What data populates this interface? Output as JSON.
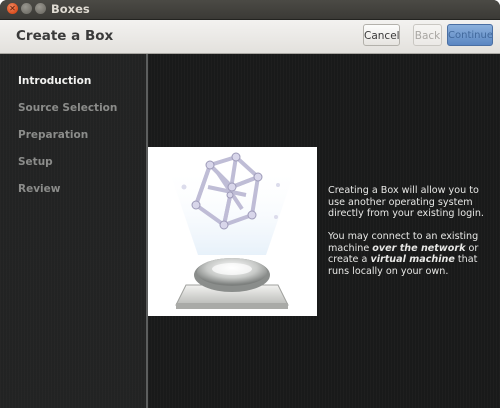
{
  "window": {
    "title": "Boxes"
  },
  "header": {
    "title": "Create a Box",
    "cancel_label": "Cancel",
    "back_label": "Back",
    "continue_label": "Continue"
  },
  "sidebar": {
    "items": [
      {
        "label": "Introduction",
        "active": true
      },
      {
        "label": "Source Selection",
        "active": false
      },
      {
        "label": "Preparation",
        "active": false
      },
      {
        "label": "Setup",
        "active": false
      },
      {
        "label": "Review",
        "active": false
      }
    ]
  },
  "main": {
    "paragraph1": "Creating a Box will allow you to use another operating system directly from your existing login.",
    "paragraph2_part1": "You may connect to an existing machine ",
    "paragraph2_bold1": "over the network",
    "paragraph2_part2": " or create a ",
    "paragraph2_bold2": "virtual machine",
    "paragraph2_part3": " that runs locally on your own."
  },
  "colors": {
    "sidebar_bg": "#232424",
    "main_bg": "#1a1b1b",
    "accent_button": "#5a86c2",
    "close_button": "#dc4f1f"
  },
  "icons": [
    "close-icon",
    "minimize-icon",
    "maximize-icon",
    "box-illustration"
  ]
}
